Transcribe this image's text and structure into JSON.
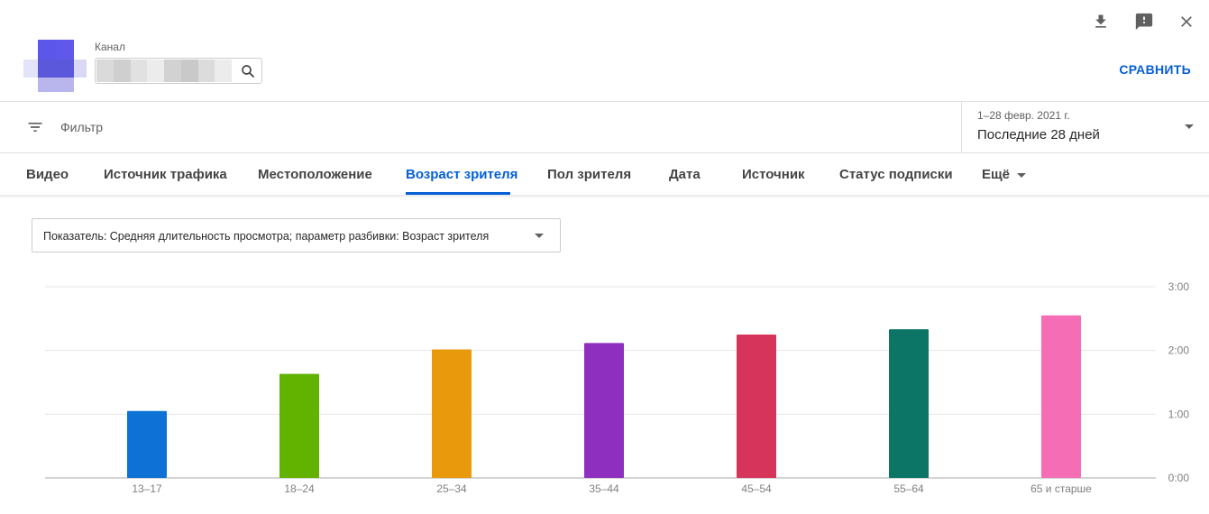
{
  "header": {
    "channel_label": "Канал",
    "channel_value": "",
    "compare_label": "СРАВНИТЬ",
    "icons": [
      "download-icon",
      "feedback-icon",
      "close-icon"
    ]
  },
  "filter": {
    "label": "Фильтр",
    "icon": "filter-icon"
  },
  "date": {
    "range": "1–28 февр. 2021 г.",
    "preset": "Последние 28 дней"
  },
  "tabs": [
    {
      "label": "Видео"
    },
    {
      "label": "Источник трафика"
    },
    {
      "label": "Местоположение"
    },
    {
      "label": "Возраст зрителя",
      "active": true
    },
    {
      "label": "Пол зрителя"
    },
    {
      "label": "Дата"
    },
    {
      "label": "Источник"
    },
    {
      "label": "Статус подписки"
    },
    {
      "label": "Ещё"
    }
  ],
  "metric_selector": {
    "label": "Показатель: Средняя длительность просмотра; параметр разбивки: Возраст зрителя"
  },
  "colors": {
    "accent": "#065fd4"
  },
  "chart_data": {
    "type": "bar",
    "categories": [
      "13–17",
      "18–24",
      "25–34",
      "35–44",
      "45–54",
      "55–64",
      "65 и старше"
    ],
    "values_seconds": [
      63,
      98,
      121,
      127,
      135,
      140,
      153
    ],
    "colors": [
      "#0d71d6",
      "#62b300",
      "#e8990c",
      "#8e2fc0",
      "#d6345a",
      "#0c7565",
      "#f56eb5"
    ],
    "y_ticks": [
      "0:00",
      "1:00",
      "2:00",
      "3:00"
    ],
    "ylim_seconds": [
      0,
      180
    ],
    "grid": true,
    "y_axis_side": "right"
  }
}
